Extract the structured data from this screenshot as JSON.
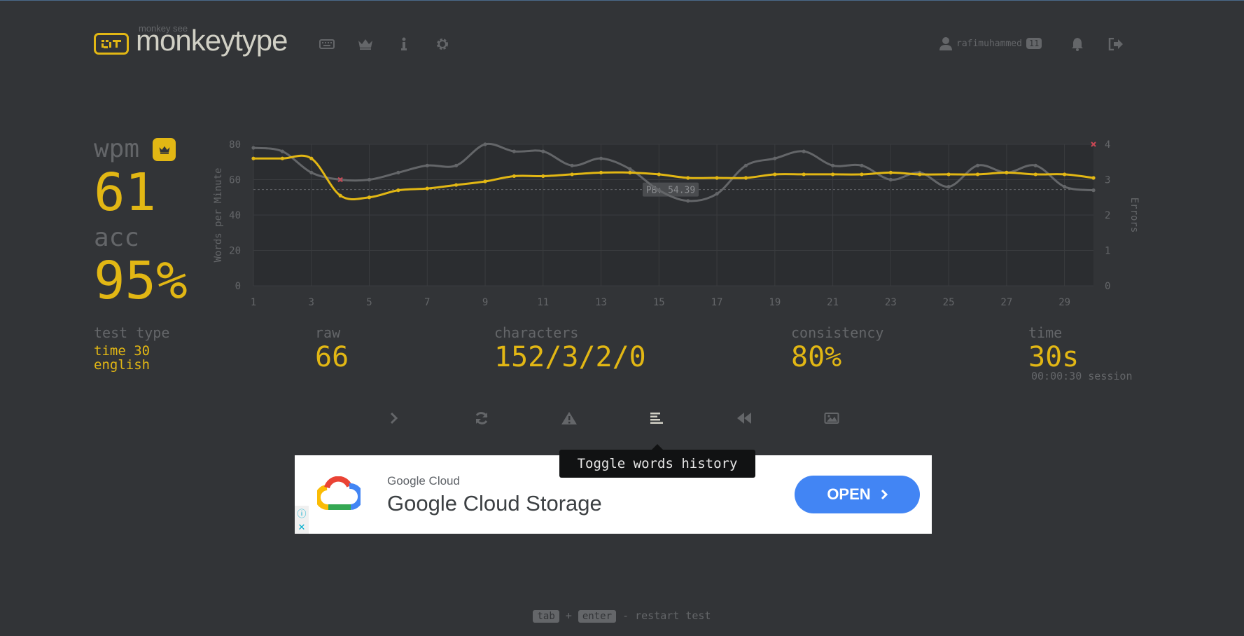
{
  "header": {
    "logo_top": "monkey see",
    "logo_text": "monkeytype",
    "nav_icons": [
      "keyboard-icon",
      "crown-icon",
      "info-icon",
      "gear-icon"
    ],
    "username": "rafimuhammed",
    "level": "11",
    "right_icons": [
      "bell-icon",
      "sign-out-icon"
    ]
  },
  "result": {
    "wpm_label": "wpm",
    "wpm_value": "61",
    "acc_label": "acc",
    "acc_value": "95%",
    "test_type_label": "test type",
    "test_type_line1": "time 30",
    "test_type_line2": "english",
    "raw_label": "raw",
    "raw_value": "66",
    "characters_label": "characters",
    "characters_value": "152/3/2/0",
    "consistency_label": "consistency",
    "consistency_value": "80%",
    "time_label": "time",
    "time_value": "30s",
    "session_text": "00:00:30 session"
  },
  "buttons": {
    "icons": [
      "chevron-right-icon",
      "restart-icon",
      "warning-icon",
      "words-history-icon",
      "replay-icon",
      "screenshot-icon"
    ],
    "tooltip": "Toggle words history"
  },
  "ad": {
    "brand": "Google Cloud",
    "title": "Google Cloud Storage",
    "button": "OPEN"
  },
  "footer": {
    "key1": "tab",
    "plus": "+",
    "key2": "enter",
    "restart_text": "- restart test"
  },
  "colors": {
    "background": "#323437",
    "main": "#e2b714",
    "sub": "#646669",
    "text": "#d1d0c5",
    "error": "#ca4754"
  },
  "chart_data": {
    "type": "line",
    "ylabel": "Words per Minute",
    "y2label": "Errors",
    "ylim": [
      0,
      80
    ],
    "y2lim": [
      0,
      4
    ],
    "yticks": [
      "0",
      "20",
      "40",
      "60",
      "80"
    ],
    "y2ticks": [
      "0",
      "1",
      "2",
      "3",
      "4"
    ],
    "xticks": [
      "1",
      "3",
      "5",
      "7",
      "9",
      "11",
      "13",
      "15",
      "17",
      "19",
      "21",
      "23",
      "25",
      "27",
      "29"
    ],
    "x": [
      1,
      2,
      3,
      4,
      5,
      6,
      7,
      8,
      9,
      10,
      11,
      12,
      13,
      14,
      15,
      16,
      17,
      18,
      19,
      20,
      21,
      22,
      23,
      24,
      25,
      26,
      27,
      28,
      29,
      30
    ],
    "series": [
      {
        "name": "wpm",
        "values": [
          72,
          72,
          72,
          51,
          50,
          54,
          55,
          57,
          59,
          62,
          62,
          63,
          64,
          64,
          63,
          61,
          61,
          61,
          63,
          63,
          63,
          63,
          64,
          63,
          63,
          63,
          64,
          63,
          63,
          61
        ]
      },
      {
        "name": "raw",
        "values": [
          78,
          76,
          64,
          60,
          60,
          64,
          68,
          68,
          80,
          76,
          76,
          68,
          72,
          66,
          54,
          48,
          52,
          68,
          72,
          76,
          68,
          68,
          60,
          64,
          56,
          68,
          64,
          68,
          56,
          54
        ]
      }
    ],
    "errors": [
      {
        "x": 4,
        "value": 3
      },
      {
        "x": 30,
        "value": 4
      }
    ],
    "pb_value": 54.39,
    "pb_label": "PB: 54.39",
    "grid": true
  }
}
